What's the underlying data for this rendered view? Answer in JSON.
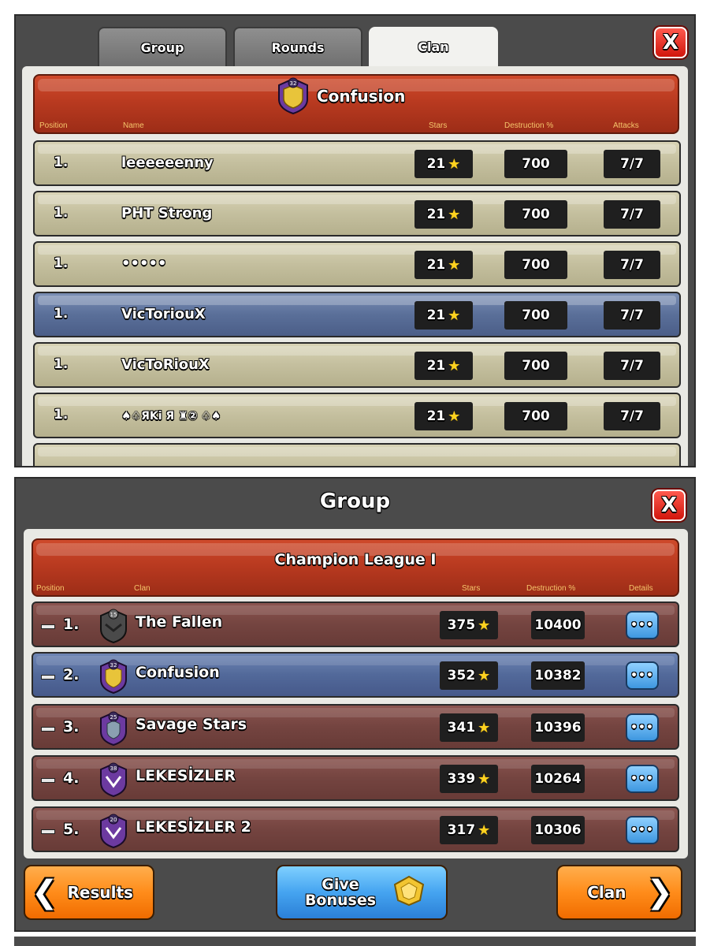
{
  "panel1": {
    "tabs": [
      {
        "label": "Group"
      },
      {
        "label": "Rounds"
      },
      {
        "label": "Clan"
      }
    ],
    "close_label": "X",
    "clan_name": "Confusion",
    "clan_level": "32",
    "columns": {
      "position": "Position",
      "name": "Name",
      "stars": "Stars",
      "destruction": "Destruction %",
      "attacks": "Attacks"
    },
    "rows": [
      {
        "position": "1.",
        "name": "leeeeeenny",
        "stars": "21",
        "destruction": "700",
        "attacks": "7/7"
      },
      {
        "position": "1.",
        "name": "PHT Strong",
        "stars": "21",
        "destruction": "700",
        "attacks": "7/7"
      },
      {
        "position": "1.",
        "name": "•••••",
        "stars": "21",
        "destruction": "700",
        "attacks": "7/7"
      },
      {
        "position": "1.",
        "name": "VicToriouX",
        "stars": "21",
        "destruction": "700",
        "attacks": "7/7"
      },
      {
        "position": "1.",
        "name": "VicToRiouX",
        "stars": "21",
        "destruction": "700",
        "attacks": "7/7"
      },
      {
        "position": "1.",
        "name": "♠♤ЯKi  Я  ♜② ♤♠",
        "stars": "21",
        "destruction": "700",
        "attacks": "7/7"
      }
    ]
  },
  "panel2": {
    "title": "Group",
    "close_label": "X",
    "league": "Champion League I",
    "columns": {
      "position": "Position",
      "clan": "Clan",
      "stars": "Stars",
      "destruction": "Destruction %",
      "details": "Details"
    },
    "rows": [
      {
        "rank": "1.",
        "badge_level": "15",
        "badge_color": "#4a4a4a",
        "name": "The Fallen",
        "stars": "375",
        "destruction": "10400",
        "details": "•••"
      },
      {
        "rank": "2.",
        "badge_level": "32",
        "badge_color": "#6c3aa0",
        "name": "Confusion",
        "stars": "352",
        "destruction": "10382",
        "details": "•••"
      },
      {
        "rank": "3.",
        "badge_level": "25",
        "badge_color": "#6c3aa0",
        "name": "Savage Stars",
        "stars": "341",
        "destruction": "10396",
        "details": "•••"
      },
      {
        "rank": "4.",
        "badge_level": "38",
        "badge_color": "#6c3aa0",
        "name": "LEKESİZLER",
        "stars": "339",
        "destruction": "10264",
        "details": "•••"
      },
      {
        "rank": "5.",
        "badge_level": "20",
        "badge_color": "#6c3aa0",
        "name": "LEKESİZLER 2",
        "stars": "317",
        "destruction": "10306",
        "details": "•••"
      }
    ],
    "buttons": {
      "results": "Results",
      "give_bonuses": "Give Bonuses",
      "clan": "Clan"
    }
  }
}
